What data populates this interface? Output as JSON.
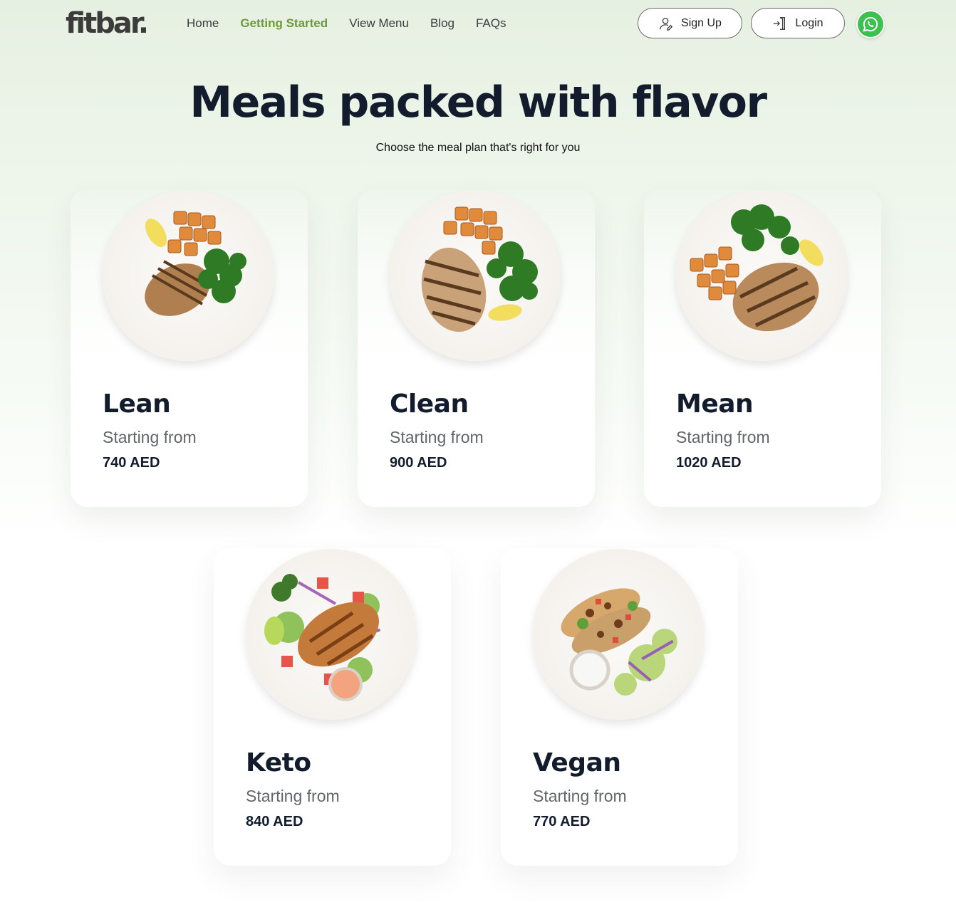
{
  "header": {
    "logo": "fitbar.",
    "nav": [
      "Home",
      "Getting Started",
      "View Menu",
      "Blog",
      "FAQs"
    ],
    "active_nav": "Getting Started",
    "signup_label": "Sign Up",
    "login_label": "Login",
    "whatsapp_icon": "whatsapp-icon"
  },
  "hero": {
    "title": "Meals packed with flavor",
    "subtitle": "Choose the meal plan that's right for you"
  },
  "plans": [
    {
      "name": "Lean",
      "starting": "Starting from",
      "price": "740 AED"
    },
    {
      "name": "Clean",
      "starting": "Starting from",
      "price": "900 AED"
    },
    {
      "name": "Mean",
      "starting": "Starting from",
      "price": "1020 AED"
    },
    {
      "name": "Keto",
      "starting": "Starting from",
      "price": "840 AED"
    },
    {
      "name": "Vegan",
      "starting": "Starting from",
      "price": "770 AED"
    }
  ],
  "colors": {
    "accent_active": "#6c9a3a",
    "heading": "#121c2d",
    "whatsapp": "#3ec051"
  }
}
